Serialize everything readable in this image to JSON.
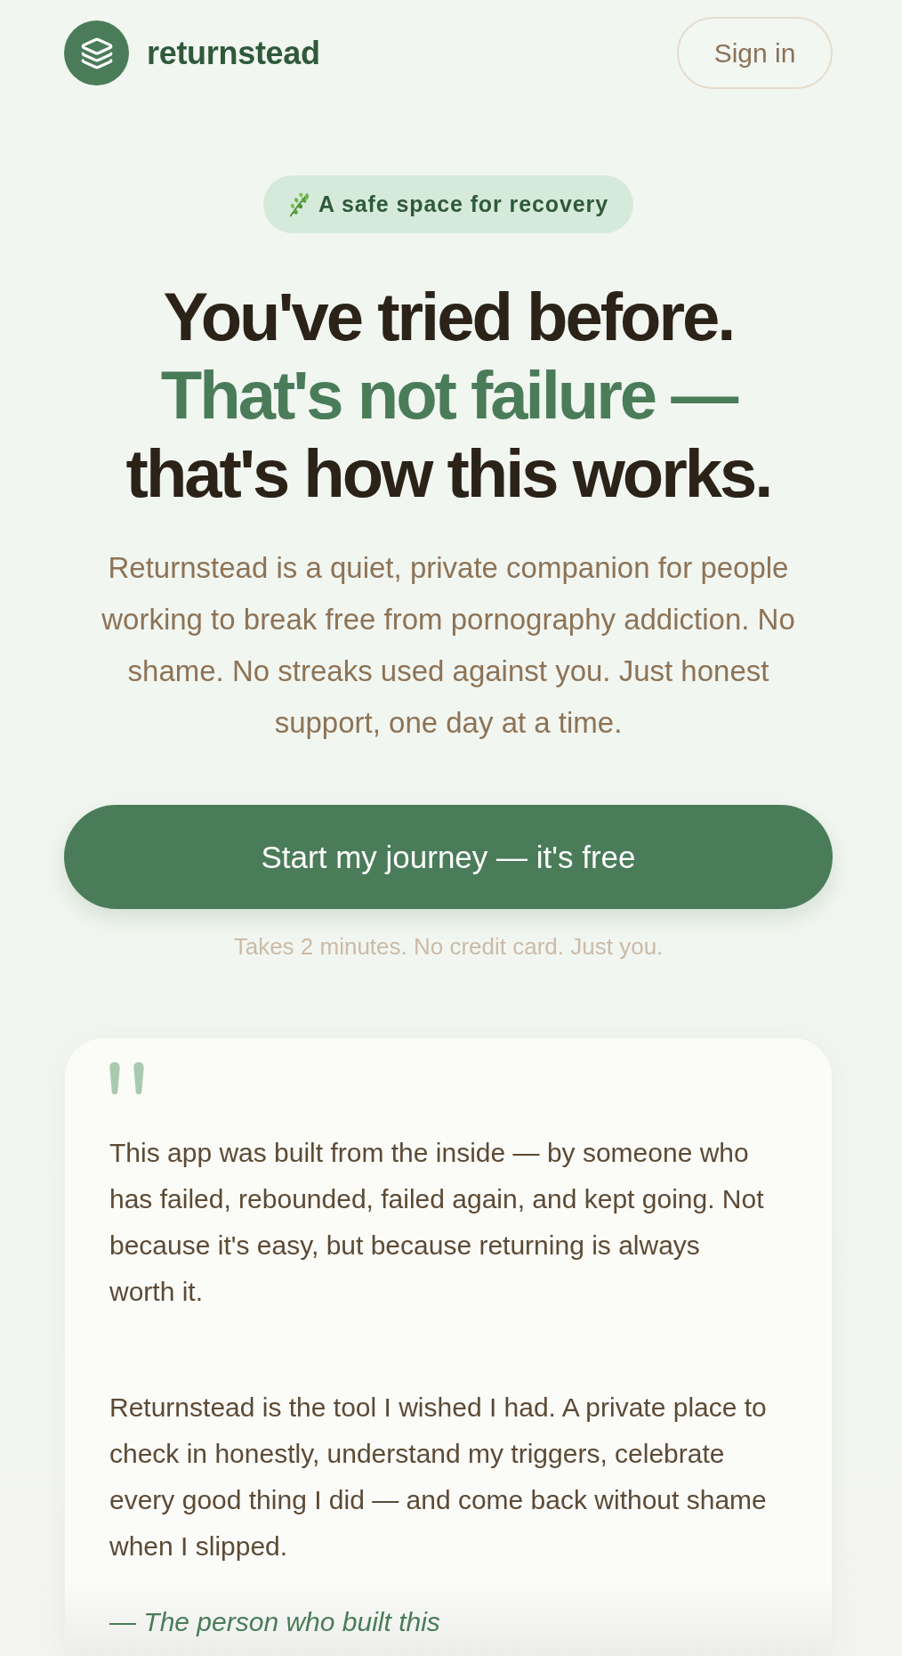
{
  "header": {
    "brand": "returnstead",
    "sign_in": "Sign in"
  },
  "hero": {
    "badge": "A safe space for recovery",
    "headline": [
      {
        "text": "You've tried before.",
        "accent": false
      },
      {
        "text": "That's not failure —",
        "accent": true
      },
      {
        "text": "that's how this works.",
        "accent": false
      }
    ],
    "intro": "Returnstead is a quiet, private companion for people working to break free from pornography addiction. No shame. No streaks used against you. Just honest support, one day at a time.",
    "cta": "Start my journey — it's free",
    "cta_note": "Takes 2 minutes. No credit card. Just you."
  },
  "story": {
    "paragraphs": [
      "This app was built from the inside — by someone who has failed, rebounded, failed again, and kept going. Not because it's easy, but because returning is always worth it.",
      "Returnstead is the tool I wished I had. A private place to check in honestly, understand my triggers, celebrate every good thing I did — and come back without shame when I slipped."
    ],
    "attribution": "— The person who built this"
  }
}
